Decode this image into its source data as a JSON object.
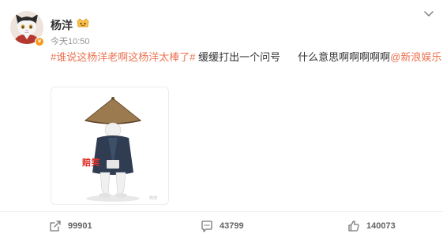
{
  "post": {
    "author": "杨洋",
    "timestamp": "今天10:50",
    "text": {
      "hashtag": "#谁说这杨洋老啊这杨洋太棒了#",
      "body1": "缓缓打出一个问号",
      "body2": "什么意思啊啊啊啊啊",
      "mention": "@新浪娱乐"
    },
    "image": {
      "sticker_caption": "赔笑",
      "watermark": "微博"
    }
  },
  "actions": {
    "repost_count": "99901",
    "comment_count": "43799",
    "like_count": "140073"
  },
  "colors": {
    "link": "#eb7350",
    "text": "#333333",
    "muted": "#939393",
    "badge_orange": "#f69a1e"
  },
  "icons": {
    "avatar": "cat-avatar",
    "verified": "verified-v-icon",
    "vip": "vip-crown-icon",
    "menu": "chevron-down-icon",
    "repost": "repost-icon",
    "comment": "comment-icon",
    "like": "like-icon"
  }
}
